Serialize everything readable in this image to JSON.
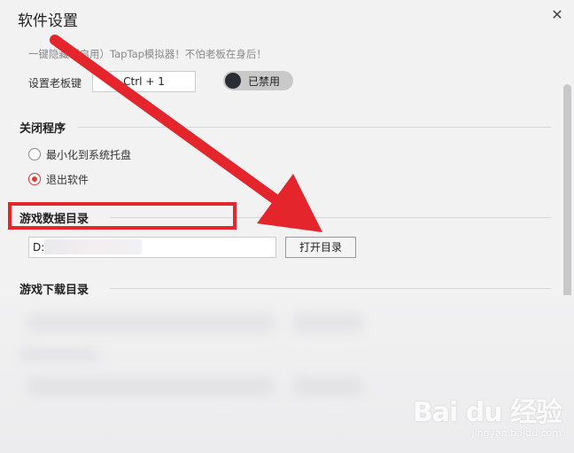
{
  "dialog": {
    "title": "软件设置",
    "close_icon": "close-icon"
  },
  "boss_key": {
    "hint": "一键隐藏（启用）TapTap模拟器！不怕老板在身后！",
    "label": "设置老板键",
    "hotkey": "Ctrl + 1",
    "toggle_label": "已禁用"
  },
  "close_program": {
    "heading": "关闭程序",
    "options": [
      {
        "label": "最小化到系统托盘",
        "checked": false
      },
      {
        "label": "退出软件",
        "checked": true
      }
    ]
  },
  "game_data_dir": {
    "heading": "游戏数据目录",
    "path": "D:\\",
    "open_button": "打开目录"
  },
  "game_download_dir": {
    "heading": "游戏下载目录"
  },
  "watermark": {
    "logo": "Bai du 经验",
    "url": "jingyan.baidu.com"
  },
  "colors": {
    "annotation": "#e4252c",
    "background": "#f2f2f3"
  }
}
